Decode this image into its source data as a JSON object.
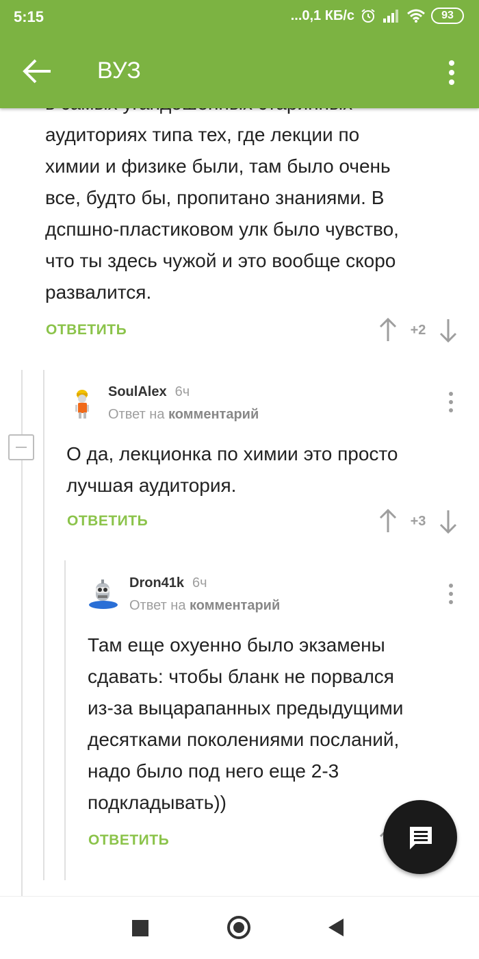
{
  "status_bar": {
    "time": "5:15",
    "network_speed": "...0,1 КБ/с",
    "battery": "93"
  },
  "header": {
    "title": "ВУЗ",
    "back_icon": "arrow-left-icon",
    "menu_icon": "more-vert-icon"
  },
  "comments": [
    {
      "text_lines": [
        "в самых угандошенных старинных",
        "аудиториях типа тех, где лекции по",
        "химии и физике были, там было очень",
        "все, будто бы, пропитано знаниями. В",
        "дспшно-пластиковом улк было чувство,",
        "что ты здесь чужой и это вообще скоро",
        "развалится."
      ],
      "reply_label": "ОТВЕТИТЬ",
      "score": "+2"
    },
    {
      "author": "SoulAlex",
      "time": "6ч",
      "reply_to_prefix": "Ответ на",
      "reply_to_target": "комментарий",
      "text_lines": [
        "О да, лекционка по химии это просто",
        "лучшая аудитория."
      ],
      "reply_label": "ОТВЕТИТЬ",
      "score": "+3"
    },
    {
      "author": "Dron41k",
      "time": "6ч",
      "reply_to_prefix": "Ответ на",
      "reply_to_target": "комментарий",
      "text_lines": [
        "Там еще охуенно было экзамены",
        "сдавать: чтобы бланк не порвался",
        "из-за выцарапанных предыдущими",
        "десятками поколениями посланий,",
        "надо было под него еще 2-3",
        "подкладывать))"
      ],
      "reply_label": "ОТВЕТИТЬ"
    }
  ],
  "fab_icon": "comment-icon",
  "navigation": {
    "recents_icon": "square-icon",
    "home_icon": "circle-icon",
    "back_icon": "triangle-back-icon"
  }
}
